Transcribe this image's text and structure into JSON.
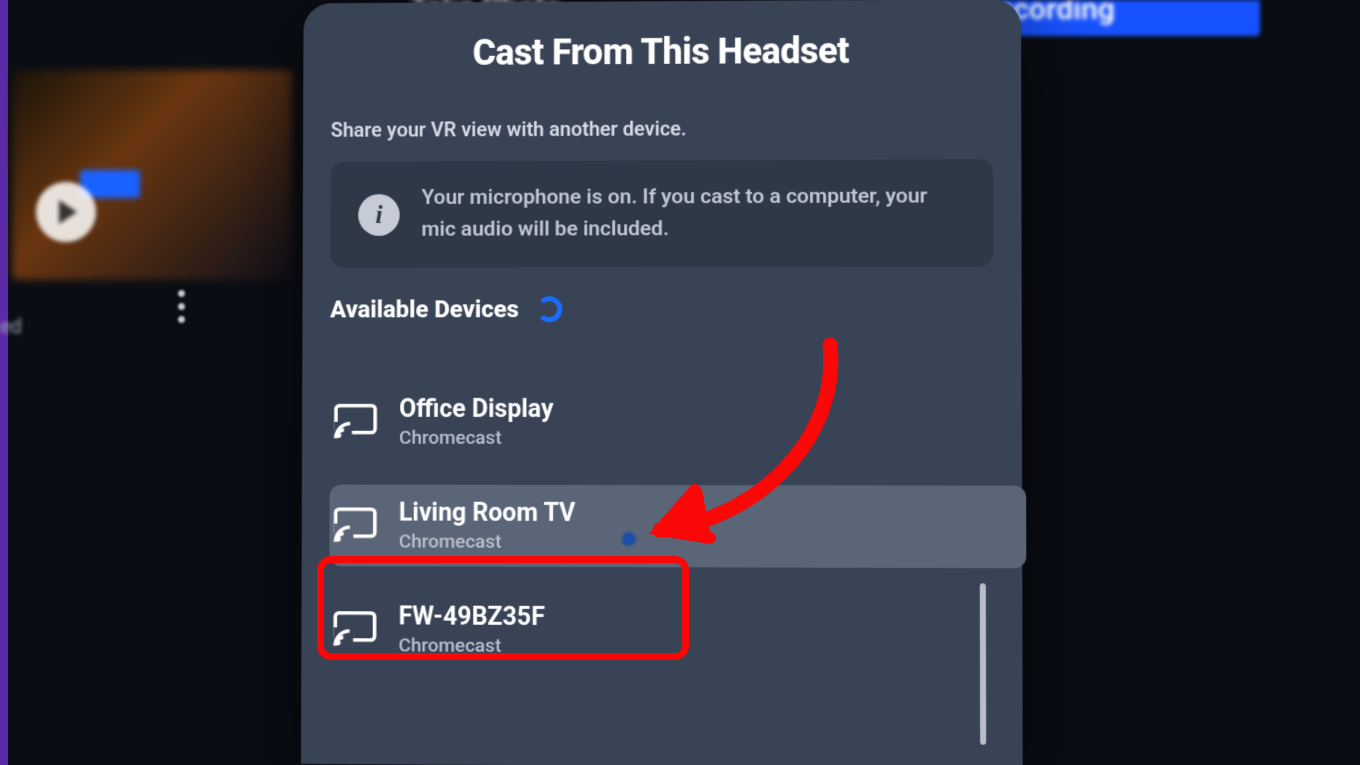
{
  "background": {
    "top_title_fragment": "Take Photo",
    "recording_label": "Recording",
    "left_caption_fragment": "ed"
  },
  "dialog": {
    "title": "Cast From This Headset",
    "subtitle": "Share your VR view with another device.",
    "info": "Your microphone is on. If you cast to a computer, your mic audio will be included.",
    "section_label": "Available Devices"
  },
  "devices": [
    {
      "name": "Office Display",
      "type": "Chromecast",
      "selected": false
    },
    {
      "name": "Living Room TV",
      "type": "Chromecast",
      "selected": true
    },
    {
      "name": "FW-49BZ35F",
      "type": "Chromecast",
      "selected": false
    }
  ],
  "annotation": {
    "highlighted_device_index": 1
  }
}
